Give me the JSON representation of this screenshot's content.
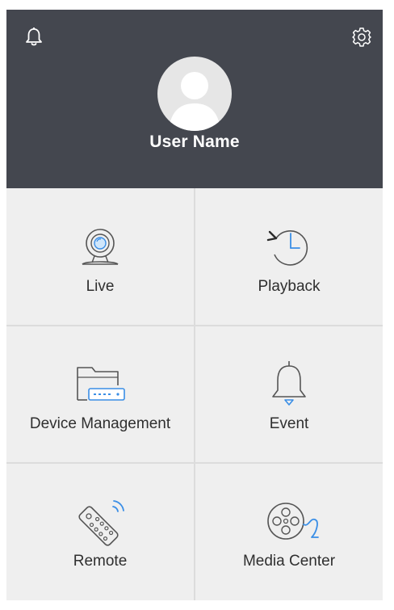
{
  "header": {
    "username": "User Name",
    "bell_icon": "bell-icon",
    "settings_icon": "gear-icon",
    "avatar_icon": "user-silhouette-icon"
  },
  "menu": [
    {
      "id": "live",
      "label": "Live",
      "icon": "webcam-icon"
    },
    {
      "id": "playback",
      "label": "Playback",
      "icon": "history-clock-icon"
    },
    {
      "id": "device-management",
      "label": "Device Management",
      "icon": "folder-device-icon"
    },
    {
      "id": "event",
      "label": "Event",
      "icon": "bell-icon"
    },
    {
      "id": "remote",
      "label": "Remote",
      "icon": "remote-control-icon"
    },
    {
      "id": "media-center",
      "label": "Media Center",
      "icon": "film-reel-icon"
    }
  ],
  "colors": {
    "header_bg": "#44474f",
    "tile_bg": "#efefef",
    "divider": "#dcdcdc",
    "accent_blue": "#3a8ee6",
    "icon_stroke": "#555555"
  }
}
